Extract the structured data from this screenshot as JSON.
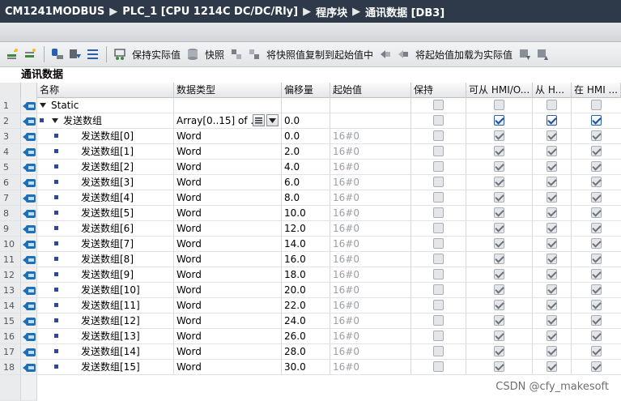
{
  "breadcrumb": {
    "items": [
      "CM1241MODBUS",
      "PLC_1 [CPU 1214C DC/DC/Rly]",
      "程序块",
      "通讯数据 [DB3]"
    ],
    "separator": "▶"
  },
  "toolbar": {
    "keep_actual_label": "保持实际值",
    "snapshot_label": "快照",
    "copy_snapshot_label": "将快照值复制到起始值中",
    "load_start_label": "将起始值加载为实际值"
  },
  "section_title": "通讯数据",
  "table": {
    "headers": {
      "name": "名称",
      "type": "数据类型",
      "offset": "偏移量",
      "start": "起始值",
      "retain": "保持",
      "hmi1": "可从 HMI/O...",
      "hmi2": "从 H...",
      "hmi3": "在 HMI ..."
    },
    "rows": [
      {
        "num": "1",
        "name": "Static",
        "type": "",
        "offset": "",
        "start": ""
      },
      {
        "num": "2",
        "name": "发送数组",
        "type": "Array[0..15] of ...",
        "offset": "0.0",
        "start": ""
      },
      {
        "num": "3",
        "name": "发送数组[0]",
        "type": "Word",
        "offset": "0.0",
        "start": "16#0"
      },
      {
        "num": "4",
        "name": "发送数组[1]",
        "type": "Word",
        "offset": "2.0",
        "start": "16#0"
      },
      {
        "num": "5",
        "name": "发送数组[2]",
        "type": "Word",
        "offset": "4.0",
        "start": "16#0"
      },
      {
        "num": "6",
        "name": "发送数组[3]",
        "type": "Word",
        "offset": "6.0",
        "start": "16#0"
      },
      {
        "num": "7",
        "name": "发送数组[4]",
        "type": "Word",
        "offset": "8.0",
        "start": "16#0"
      },
      {
        "num": "8",
        "name": "发送数组[5]",
        "type": "Word",
        "offset": "10.0",
        "start": "16#0"
      },
      {
        "num": "9",
        "name": "发送数组[6]",
        "type": "Word",
        "offset": "12.0",
        "start": "16#0"
      },
      {
        "num": "10",
        "name": "发送数组[7]",
        "type": "Word",
        "offset": "14.0",
        "start": "16#0"
      },
      {
        "num": "11",
        "name": "发送数组[8]",
        "type": "Word",
        "offset": "16.0",
        "start": "16#0"
      },
      {
        "num": "12",
        "name": "发送数组[9]",
        "type": "Word",
        "offset": "18.0",
        "start": "16#0"
      },
      {
        "num": "13",
        "name": "发送数组[10]",
        "type": "Word",
        "offset": "20.0",
        "start": "16#0"
      },
      {
        "num": "14",
        "name": "发送数组[11]",
        "type": "Word",
        "offset": "22.0",
        "start": "16#0"
      },
      {
        "num": "15",
        "name": "发送数组[12]",
        "type": "Word",
        "offset": "24.0",
        "start": "16#0"
      },
      {
        "num": "16",
        "name": "发送数组[13]",
        "type": "Word",
        "offset": "26.0",
        "start": "16#0"
      },
      {
        "num": "17",
        "name": "发送数组[14]",
        "type": "Word",
        "offset": "28.0",
        "start": "16#0"
      },
      {
        "num": "18",
        "name": "发送数组[15]",
        "type": "Word",
        "offset": "30.0",
        "start": "16#0"
      }
    ]
  },
  "watermark": "CSDN @cfy_makesoft",
  "colors": {
    "titlebar": "#2e3a4a",
    "accent": "#2a46a8",
    "row_icon": "#1f6fb6"
  }
}
